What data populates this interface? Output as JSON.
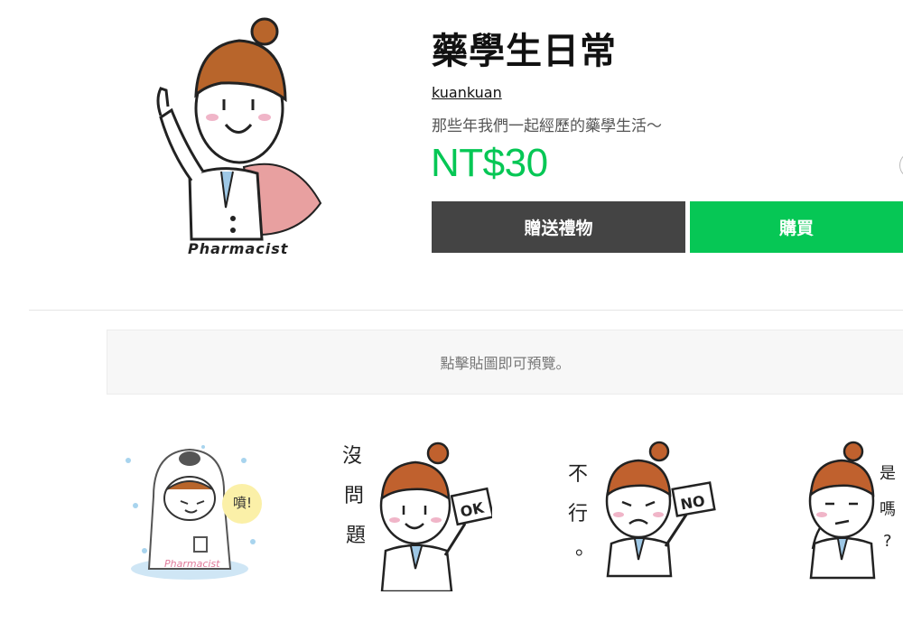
{
  "product": {
    "title": "藥學生日常",
    "author": "kuankuan",
    "description": "那些年我們一起經歷的藥學生活～",
    "price": "NT$30",
    "main_image_caption": "Pharmacist"
  },
  "buttons": {
    "gift_label": "贈送禮物",
    "buy_label": "購買"
  },
  "preview": {
    "hint": "點擊貼圖即可預覽。"
  },
  "stickers": [
    {
      "name": "sticker-pharmacist-cold",
      "bubble_text": "噴!"
    },
    {
      "name": "sticker-no-problem",
      "side_text": "沒問題",
      "sign_text": "OK"
    },
    {
      "name": "sticker-not-ok",
      "side_text": "不行。",
      "sign_text": "NO"
    },
    {
      "name": "sticker-is-that-so",
      "side_text": "是嗎?"
    }
  ],
  "colors": {
    "accent_green": "#06c755",
    "gift_button": "#444444",
    "hair": "#b8652b",
    "cape": "#e8a0a0"
  }
}
